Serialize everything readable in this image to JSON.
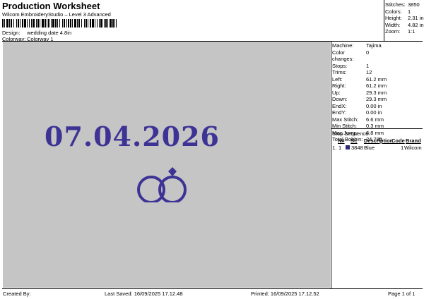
{
  "header": {
    "title": "Production Worksheet",
    "subtitle": "Wilcom EmbroideryStudio – Level 3 Advanced"
  },
  "design": {
    "label": "Design:",
    "value": "wedding date 4.8in"
  },
  "colorway": {
    "label": "Colorway:",
    "value": "Colorway 1"
  },
  "top_stats": [
    {
      "label": "Stitches:",
      "value": "3850"
    },
    {
      "label": "Colors:",
      "value": "1"
    },
    {
      "label": "Height:",
      "value": "2.31 in"
    },
    {
      "label": "Width:",
      "value": "4.82 in"
    },
    {
      "label": "Zoom:",
      "value": "1:1"
    }
  ],
  "design_preview": {
    "text": "07.04.2026",
    "thread_color": "#3d3395",
    "background": "#c5c5c5"
  },
  "machine_info": [
    {
      "label": "Machine:",
      "value": "Tajima"
    },
    {
      "label": "Color changes:",
      "value": "0"
    },
    {
      "label": "Stops:",
      "value": "1"
    },
    {
      "label": "Trims:",
      "value": "12"
    },
    {
      "label": "Left:",
      "value": "61.2 mm"
    },
    {
      "label": "Right:",
      "value": "61.2 mm"
    },
    {
      "label": "Up:",
      "value": "29.3 mm"
    },
    {
      "label": "Down:",
      "value": "29.3 mm"
    },
    {
      "label": "EndX:",
      "value": "0.00 in"
    },
    {
      "label": "EndY:",
      "value": "0.00 in"
    },
    {
      "label": "Max Stitch:",
      "value": "6.6 mm"
    },
    {
      "label": "Min Stitch:",
      "value": "0.3 mm"
    },
    {
      "label": "Max Jump:",
      "value": "6.8 mm"
    },
    {
      "label": "Total Bobbin:",
      "value": "24.78ft"
    }
  ],
  "stop_sequence": {
    "title": "Stop Sequence:",
    "headers": [
      "N#",
      "St.",
      "Description",
      "Code",
      "Brand"
    ],
    "rows": [
      {
        "index": "1.",
        "needle": "1",
        "swatch_color": "#2e2a72",
        "stitches": "3848",
        "description": "Blue",
        "code": "1",
        "brand": "Wilcom"
      }
    ]
  },
  "footer": {
    "created_by": "Created By:",
    "last_saved": "Last Saved: 16/09/2025 17.12.48",
    "printed": "Printed: 16/09/2025 17.12.52",
    "page": "Page 1 of 1"
  }
}
